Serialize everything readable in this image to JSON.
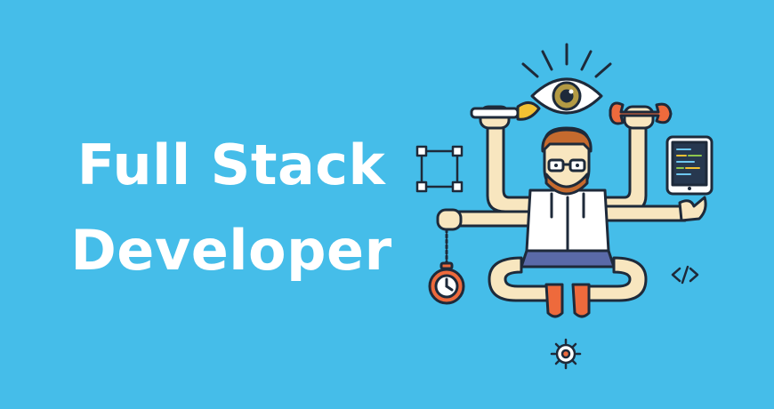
{
  "banner": {
    "title_line_1": "Full Stack",
    "title_line_2": "Developer"
  },
  "illustration": {
    "icons": [
      "eye-icon",
      "paintbrush-icon",
      "wrench-icon",
      "selection-box-icon",
      "tablet-icon",
      "pocket-watch-icon",
      "code-brackets-icon",
      "gear-icon"
    ]
  },
  "colors": {
    "background": "#45bde9",
    "text": "#ffffff",
    "outline": "#1e2a3a",
    "skin": "#f8e6bf",
    "hair": "#c56a2e",
    "accent_orange": "#ee6a3c",
    "pants": "#5a6aa8",
    "tablet_screen": "#27384f"
  }
}
